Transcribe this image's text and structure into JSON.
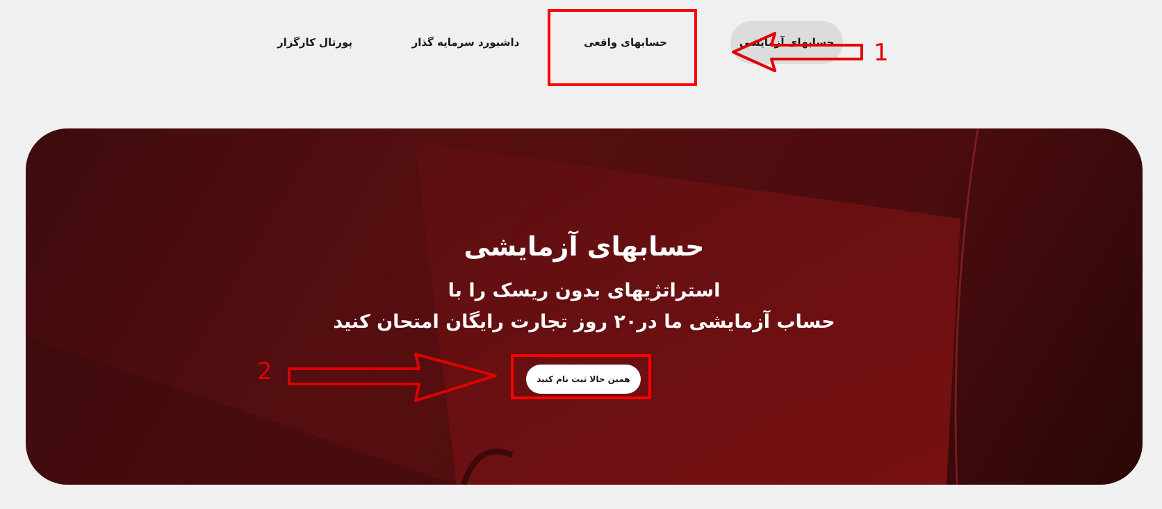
{
  "nav": {
    "tabs": [
      {
        "label": "حسابهای آزمایشی",
        "active": true
      },
      {
        "label": "حسابهای واقعی",
        "active": false
      },
      {
        "label": "داشبورد سرمایه گذار",
        "active": false
      },
      {
        "label": "پورتال کارگزار",
        "active": false
      }
    ]
  },
  "hero": {
    "title": "حسابهای آزمایشی",
    "line1": "استراتژیهای بدون ریسک را با",
    "line2": "حساب آزمایشی ما در۲۰ روز تجارت رایگان امتحان کنید",
    "cta_label": "همین حالا ثبت نام کنید"
  },
  "annotations": {
    "marker_1": "1",
    "marker_2": "2"
  },
  "colors": {
    "page_background": "#f0f0f0",
    "hero_dark": "#4a0c0e",
    "hero_accent": "#7a1012",
    "annotation": "#ff0000",
    "active_tab": "#dcdcdc"
  }
}
